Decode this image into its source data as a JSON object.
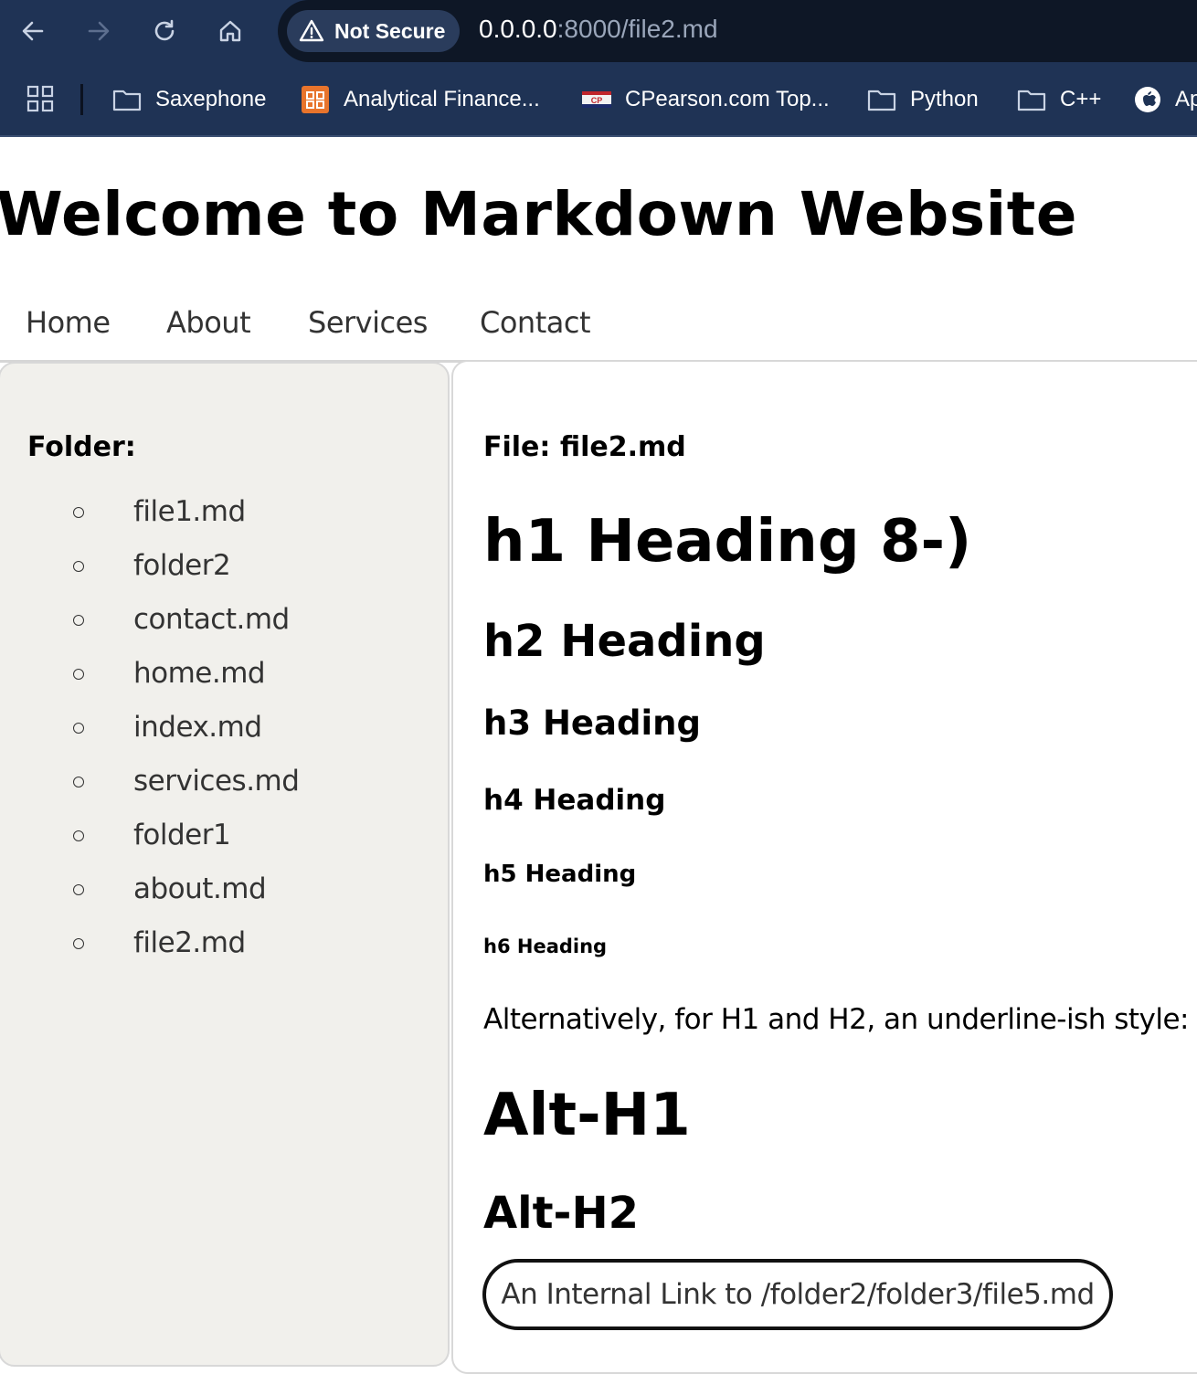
{
  "browser": {
    "security_label": "Not Secure",
    "url_host": "0.0.0.0",
    "url_path": ":8000/file2.md",
    "bookmarks": [
      {
        "label": "Saxephone",
        "icon": "folder-icon"
      },
      {
        "label": "Analytical Finance...",
        "icon": "site-favicon"
      },
      {
        "label": "CPearson.com Top...",
        "icon": "site-favicon"
      },
      {
        "label": "Python",
        "icon": "folder-icon"
      },
      {
        "label": "C++",
        "icon": "folder-icon"
      },
      {
        "label": "Ap",
        "icon": "apple-icon"
      }
    ]
  },
  "page": {
    "title": "Welcome to Markdown Website",
    "nav": [
      "Home",
      "About",
      "Services",
      "Contact"
    ]
  },
  "sidebar": {
    "heading": "Folder:",
    "items": [
      "file1.md",
      "folder2",
      "contact.md",
      "home.md",
      "index.md",
      "services.md",
      "folder1",
      "about.md",
      "file2.md"
    ]
  },
  "content": {
    "file_label": "File: file2.md",
    "h1": "h1 Heading 8-)",
    "h2": "h2 Heading",
    "h3": "h3 Heading",
    "h4": "h4 Heading",
    "h5": "h5 Heading",
    "h6": "h6 Heading",
    "paragraph": "Alternatively, for H1 and H2, an underline-ish style:",
    "alt_h1": "Alt-H1",
    "alt_h2": "Alt-H2",
    "internal_link": "An Internal Link to /folder2/folder3/file5.md"
  }
}
